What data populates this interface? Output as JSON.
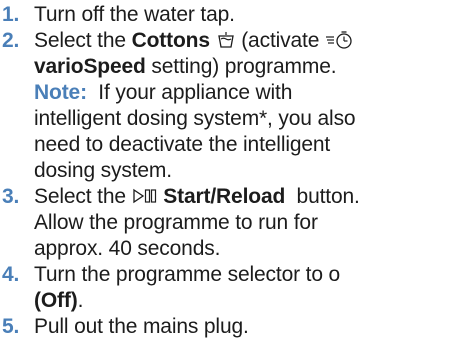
{
  "steps": [
    {
      "number": "1.",
      "text": "Turn off the water tap."
    },
    {
      "number": "2.",
      "pre": "Select the ",
      "bold1": "Cottons",
      "icon1": "cottons-tub-icon",
      "mid": " (activate ",
      "icon2": "variospeed-clock-icon",
      "bold2": "varioSpeed",
      "post": " setting) programme.",
      "note_label": "Note:",
      "note_lines": [
        "If your appliance with",
        "intelligent dosing system*, you also",
        "need to deactivate the intelligent",
        "dosing system."
      ]
    },
    {
      "number": "3.",
      "pre": "Select the ",
      "icon": "start-pause-icon",
      "bold": "Start/Reload",
      "post": "  button.",
      "lines": [
        "Allow the programme to run for",
        "approx. 40 seconds."
      ]
    },
    {
      "number": "4.",
      "pre": "Turn the programme selector to ",
      "symbol": "o",
      "bold": "(Off)",
      "post": "."
    },
    {
      "number": "5.",
      "text": "Pull out the mains plug."
    }
  ],
  "colors": {
    "accent": "#4a7fb8",
    "text": "#1c1c1c"
  }
}
